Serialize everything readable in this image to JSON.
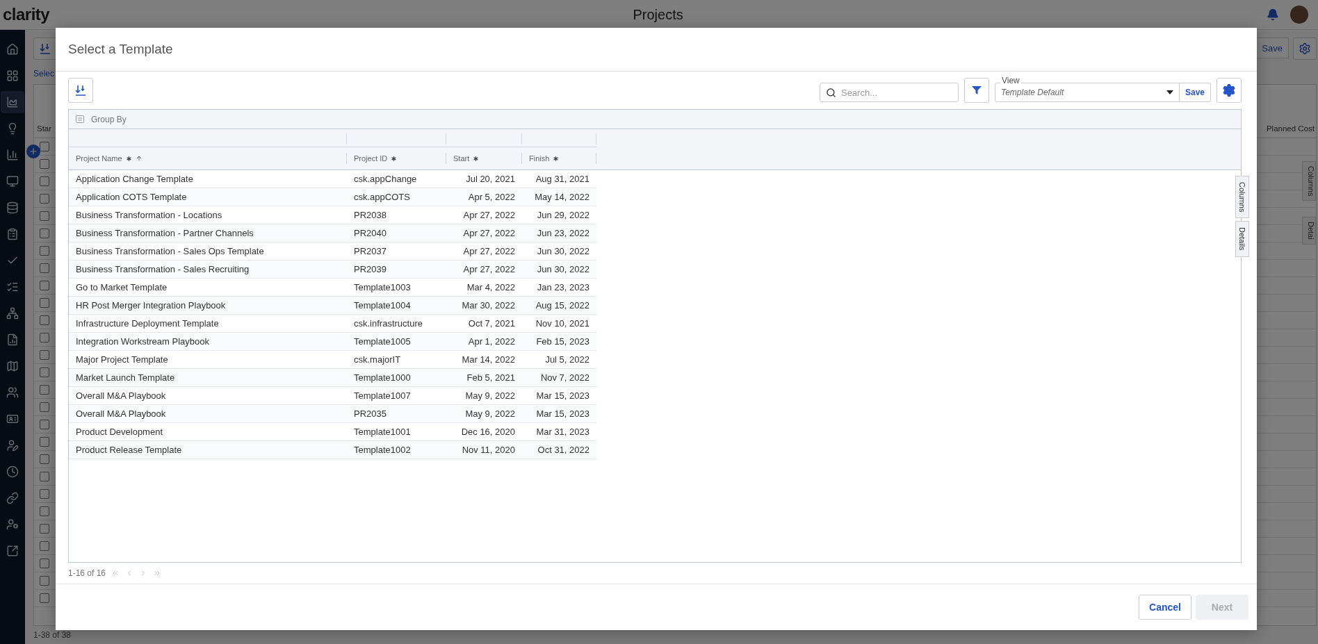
{
  "app": {
    "logo": "clarity",
    "title": "Projects"
  },
  "sidebar": {
    "items": [
      {
        "selected": false
      },
      {
        "selected": false
      },
      {
        "selected": true
      },
      {
        "selected": false
      },
      {
        "selected": false
      },
      {
        "selected": false
      },
      {
        "selected": false
      },
      {
        "selected": false
      },
      {
        "selected": false
      },
      {
        "selected": false
      },
      {
        "selected": false
      },
      {
        "selected": false
      },
      {
        "selected": false
      },
      {
        "selected": false
      },
      {
        "selected": false
      },
      {
        "selected": false
      },
      {
        "selected": false
      },
      {
        "selected": false
      },
      {
        "selected": false
      },
      {
        "selected": false
      }
    ]
  },
  "background": {
    "link": "Selec",
    "save": "Save",
    "first_column": "Star",
    "last_column": "Planned Cost",
    "side_tabs": [
      "Columns",
      "Detai"
    ],
    "pager": "1-38 of 38",
    "rows": [
      {
        "checked": false
      },
      {
        "checked": false
      },
      {
        "checked": false
      },
      {
        "checked": false
      },
      {
        "checked": false
      },
      {
        "checked": false
      },
      {
        "checked": false
      },
      {
        "checked": false
      },
      {
        "checked": false
      },
      {
        "checked": false
      },
      {
        "checked": false
      },
      {
        "checked": false
      },
      {
        "checked": false
      },
      {
        "checked": false
      },
      {
        "checked": false
      },
      {
        "checked": false
      },
      {
        "checked": false
      },
      {
        "checked": false
      },
      {
        "checked": false
      },
      {
        "checked": false
      },
      {
        "checked": false
      },
      {
        "checked": false
      },
      {
        "checked": false
      },
      {
        "checked": false
      },
      {
        "checked": false
      },
      {
        "checked": false
      },
      {
        "checked": false
      }
    ]
  },
  "dialog": {
    "title": "Select a Template",
    "search": {
      "placeholder": "Search..."
    },
    "view": {
      "label": "View",
      "value": "Template Default",
      "save": "Save"
    },
    "group_by": "Group By",
    "columns": [
      {
        "label": "Project Name",
        "kind": "text",
        "required": true,
        "sorted": true
      },
      {
        "label": "Project ID",
        "kind": "text",
        "required": true,
        "sorted": false
      },
      {
        "label": "Start",
        "kind": "date",
        "required": true,
        "sorted": false
      },
      {
        "label": "Finish",
        "kind": "date",
        "required": true,
        "sorted": false
      }
    ],
    "rows": [
      [
        "Application Change Template",
        "csk.appChange",
        "Jul 20, 2021",
        "Aug 31, 2021"
      ],
      [
        "Application COTS Template",
        "csk.appCOTS",
        "Apr 5, 2022",
        "May 14, 2022"
      ],
      [
        "Business Transformation - Locations",
        "PR2038",
        "Apr 27, 2022",
        "Jun 29, 2022"
      ],
      [
        "Business Transformation - Partner Channels",
        "PR2040",
        "Apr 27, 2022",
        "Jun 23, 2022"
      ],
      [
        "Business Transformation - Sales Ops Template",
        "PR2037",
        "Apr 27, 2022",
        "Jun 30, 2022"
      ],
      [
        "Business Transformation - Sales Recruiting",
        "PR2039",
        "Apr 27, 2022",
        "Jun 30, 2022"
      ],
      [
        "Go to Market Template",
        "Template1003",
        "Mar 4, 2022",
        "Jan 23, 2023"
      ],
      [
        "HR Post Merger Integration Playbook",
        "Template1004",
        "Mar 30, 2022",
        "Aug 15, 2022"
      ],
      [
        "Infrastructure Deployment Template",
        "csk.infrastructure",
        "Oct 7, 2021",
        "Nov 10, 2021"
      ],
      [
        "Integration Workstream Playbook",
        "Template1005",
        "Apr 1, 2022",
        "Feb 15, 2023"
      ],
      [
        "Major Project Template",
        "csk.majorIT",
        "Mar 14, 2022",
        "Jul 5, 2022"
      ],
      [
        "Market Launch Template",
        "Template1000",
        "Feb 5, 2021",
        "Nov 7, 2022"
      ],
      [
        "Overall M&A Playbook",
        "Template1007",
        "May 9, 2022",
        "Mar 15, 2023"
      ],
      [
        "Overall M&A Playbook",
        "PR2035",
        "May 9, 2022",
        "Mar 15, 2023"
      ],
      [
        "Product Development",
        "Template1001",
        "Dec 16, 2020",
        "Mar 31, 2023"
      ],
      [
        "Product Release Template",
        "Template1002",
        "Nov 11, 2020",
        "Oct 31, 2022"
      ]
    ],
    "side_tabs": [
      "Columns",
      "Details"
    ],
    "pager": "1-16 of 16",
    "buttons": [
      {
        "label": "Cancel",
        "disabled": false
      },
      {
        "label": "Next",
        "disabled": true
      }
    ]
  }
}
